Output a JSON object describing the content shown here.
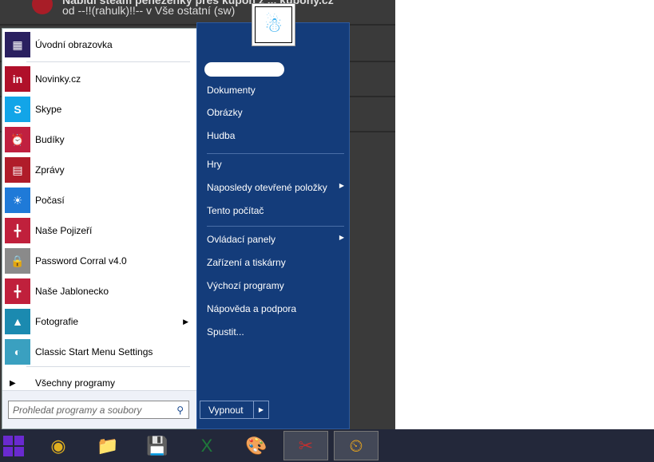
{
  "background": {
    "line1": "Nabídl steam peněženky přes kupón z ... kupony.cz",
    "line2": "od --!!(rahulk)!!-- v Vše ostatní (sw)"
  },
  "left_items": [
    {
      "label": "Úvodní obrazovka",
      "icon": "start-screen-icon",
      "color": "#2a2060",
      "glyph": "▦"
    },
    {
      "label": "Novinky.cz",
      "icon": "novinky-icon",
      "color": "#b0102a",
      "glyph": "in"
    },
    {
      "label": "Skype",
      "icon": "skype-icon",
      "color": "#12a5e8",
      "glyph": "S"
    },
    {
      "label": "Budíky",
      "icon": "alarm-icon",
      "color": "#c02040",
      "glyph": "⏰"
    },
    {
      "label": "Zprávy",
      "icon": "news-icon",
      "color": "#b01c2a",
      "glyph": "▤"
    },
    {
      "label": "Počasí",
      "icon": "weather-icon",
      "color": "#1f7ad8",
      "glyph": "☀"
    },
    {
      "label": "Naše Pojizeří",
      "icon": "pojizeri-icon",
      "color": "#c0203c",
      "glyph": "╋"
    },
    {
      "label": "Password Corral v4.0",
      "icon": "password-icon",
      "color": "#8a8a8a",
      "glyph": "🔒"
    },
    {
      "label": "Naše Jablonecko",
      "icon": "jablonecko-icon",
      "color": "#c0203c",
      "glyph": "╋"
    },
    {
      "label": "Fotografie",
      "icon": "photos-icon",
      "color": "#1b8ab0",
      "glyph": "▲",
      "submenu": true
    },
    {
      "label": "Classic Start Menu Settings",
      "icon": "shell-icon",
      "color": "#3aa0c0",
      "glyph": "◐"
    }
  ],
  "all_programs": "Všechny programy",
  "search_placeholder": "Prohledat programy a soubory",
  "right_items": [
    {
      "label": "Dokumenty"
    },
    {
      "label": "Obrázky"
    },
    {
      "label": "Hudba"
    },
    {
      "label": "Hry"
    },
    {
      "label": "Naposledy otevřené položky",
      "submenu": true
    },
    {
      "label": "Tento počítač"
    },
    {
      "label": "Ovládací panely",
      "submenu": true
    },
    {
      "label": "Zařízení a tiskárny"
    },
    {
      "label": "Výchozí programy"
    },
    {
      "label": "Nápověda a podpora"
    },
    {
      "label": "Spustit..."
    }
  ],
  "shutdown": "Vypnout",
  "taskbar": [
    {
      "name": "chrome",
      "glyph": "◉",
      "color": "#e0b020"
    },
    {
      "name": "file-explorer",
      "glyph": "📁",
      "color": "#f0c050"
    },
    {
      "name": "floppy-64",
      "glyph": "💾",
      "color": "#2040c0"
    },
    {
      "name": "excel",
      "glyph": "X",
      "color": "#1e7a3a"
    },
    {
      "name": "paint",
      "glyph": "🎨",
      "color": "#e08030"
    },
    {
      "name": "snipping-tool",
      "glyph": "✂",
      "color": "#c03030"
    },
    {
      "name": "outlook-calendar",
      "glyph": "⏲",
      "color": "#e0a020"
    }
  ]
}
